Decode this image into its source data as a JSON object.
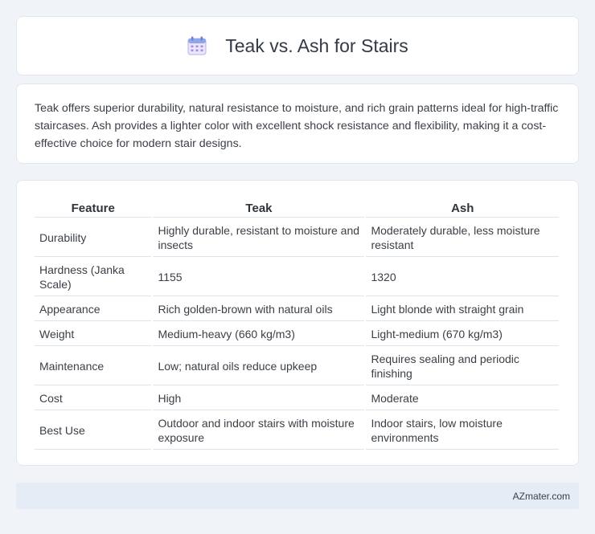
{
  "header": {
    "title": "Teak vs. Ash for Stairs",
    "icon": "calendar-icon"
  },
  "description": "Teak offers superior durability, natural resistance to moisture, and rich grain patterns ideal for high-traffic staircases. Ash provides a lighter color with excellent shock resistance and flexibility, making it a cost-effective choice for modern stair designs.",
  "table": {
    "headers": [
      "Feature",
      "Teak",
      "Ash"
    ],
    "rows": [
      [
        "Durability",
        "Highly durable, resistant to moisture and insects",
        "Moderately durable, less moisture resistant"
      ],
      [
        "Hardness (Janka Scale)",
        "1155",
        "1320"
      ],
      [
        "Appearance",
        "Rich golden-brown with natural oils",
        "Light blonde with straight grain"
      ],
      [
        "Weight",
        "Medium-heavy (660 kg/m3)",
        "Light-medium (670 kg/m3)"
      ],
      [
        "Maintenance",
        "Low; natural oils reduce upkeep",
        "Requires sealing and periodic finishing"
      ],
      [
        "Cost",
        "High",
        "Moderate"
      ],
      [
        "Best Use",
        "Outdoor and indoor stairs with moisture exposure",
        "Indoor stairs, low moisture environments"
      ]
    ]
  },
  "footer": {
    "text": "AZmater.com"
  },
  "colors": {
    "background": "#f0f3f8",
    "card": "#ffffff",
    "footer_bg": "#e6ecf6",
    "icon_accent": "#8a7fe0"
  }
}
